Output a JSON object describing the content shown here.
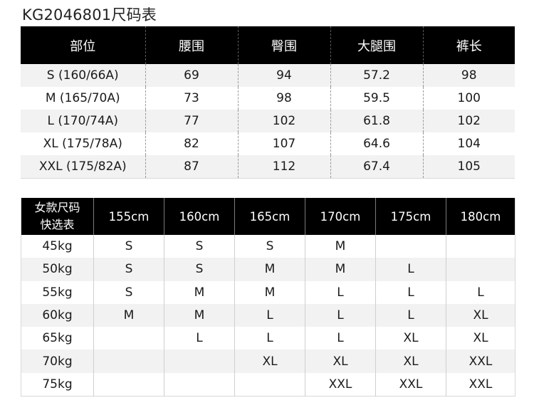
{
  "title": "KG2046801尺码表",
  "size_chart": {
    "headers": [
      "部位",
      "腰围",
      "臀围",
      "大腿围",
      "裤长"
    ],
    "rows": [
      [
        "S (160/66A)",
        "69",
        "94",
        "57.2",
        "98"
      ],
      [
        "M (165/70A)",
        "73",
        "98",
        "59.5",
        "100"
      ],
      [
        "L (170/74A)",
        "77",
        "102",
        "61.8",
        "102"
      ],
      [
        "XL (175/78A)",
        "82",
        "107",
        "64.6",
        "104"
      ],
      [
        "XXL (175/82A)",
        "87",
        "112",
        "67.4",
        "105"
      ]
    ]
  },
  "quick_chart": {
    "corner_line1": "女款尺码",
    "corner_line2": "快选表",
    "heights": [
      "155cm",
      "160cm",
      "165cm",
      "170cm",
      "175cm",
      "180cm"
    ],
    "rows": [
      [
        "45kg",
        "S",
        "S",
        "S",
        "M",
        "",
        ""
      ],
      [
        "50kg",
        "S",
        "S",
        "M",
        "M",
        "L",
        ""
      ],
      [
        "55kg",
        "S",
        "M",
        "M",
        "L",
        "L",
        "L"
      ],
      [
        "60kg",
        "M",
        "M",
        "L",
        "L",
        "L",
        "XL"
      ],
      [
        "65kg",
        "",
        "L",
        "L",
        "L",
        "XL",
        "XL"
      ],
      [
        "70kg",
        "",
        "",
        "XL",
        "XL",
        "XL",
        "XXL"
      ],
      [
        "75kg",
        "",
        "",
        "",
        "XXL",
        "XXL",
        "XXL"
      ]
    ]
  }
}
